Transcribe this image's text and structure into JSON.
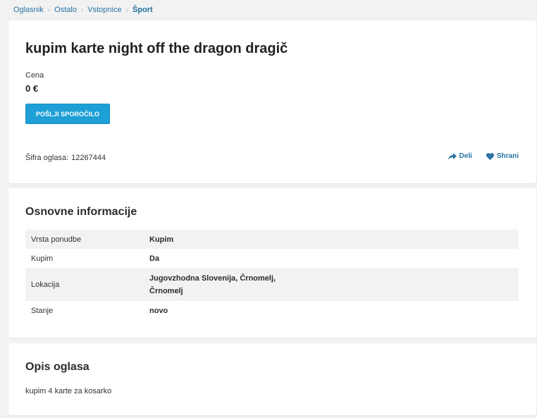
{
  "breadcrumb": [
    {
      "label": "Oglasnik"
    },
    {
      "label": "Ostalo"
    },
    {
      "label": "Vstopnice"
    },
    {
      "label": "Šport"
    }
  ],
  "ad": {
    "title": "kupim karte night off the dragon dragič",
    "price_label": "Cena",
    "price_value": "0 €",
    "send_message_label": "POŠLJI SPOROČILO",
    "code_label": "Šifra oglasa:",
    "code_value": "12267444",
    "share_label": "Deli",
    "save_label": "Shrani"
  },
  "info": {
    "title": "Osnovne informacije",
    "rows": [
      {
        "key": "Vrsta ponudbe",
        "value": "Kupim"
      },
      {
        "key": "Kupim",
        "value": "Da"
      },
      {
        "key": "Lokacija",
        "value_line1": "Jugovzhodna Slovenija, Črnomelj,",
        "value_line2": "Črnomelj"
      },
      {
        "key": "Stanje",
        "value": "novo"
      }
    ]
  },
  "description": {
    "title": "Opis oglasa",
    "text": "kupim 4 karte za kosarko"
  },
  "colors": {
    "accent": "#1ea0d6",
    "link": "#2a72a3",
    "background": "#f2f2f2"
  }
}
